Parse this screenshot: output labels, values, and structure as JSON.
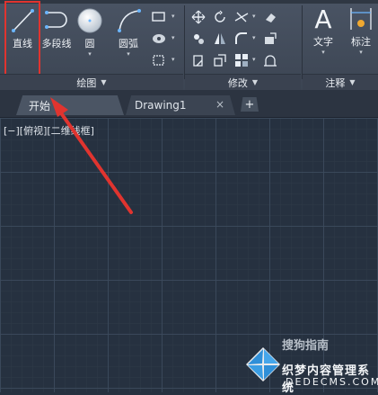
{
  "ribbon": {
    "tools": {
      "line": "直线",
      "polyline": "多段线",
      "circle": "圆",
      "arc": "圆弧",
      "text": "文字",
      "dimension": "标注"
    },
    "groups": {
      "draw": "绘图",
      "modify": "修改",
      "annotate": "注释"
    }
  },
  "tabs": {
    "start": "开始",
    "drawing": "Drawing1",
    "close": "×",
    "new": "+"
  },
  "canvas": {
    "viewport_label": "[−][俯视][二维线框]"
  },
  "watermark": {
    "sub": "搜狗指南",
    "title": "织梦内容管理系统",
    "url": "DEDECMS.COM"
  },
  "colors": {
    "highlight": "#e0342f",
    "canvas_bg": "#263140"
  }
}
